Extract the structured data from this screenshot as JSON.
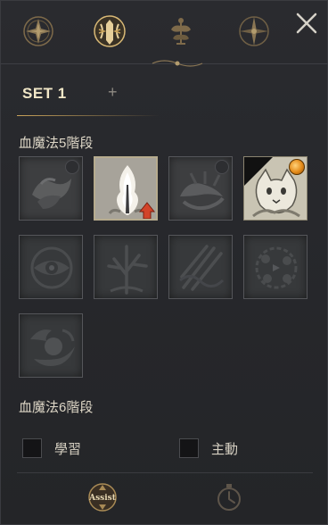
{
  "tabs": [
    {
      "icon": "compass-star-icon"
    },
    {
      "icon": "crest-emblem-icon",
      "selected": true
    },
    {
      "icon": "ornament-tree-icon"
    },
    {
      "icon": "compass-rose-icon"
    }
  ],
  "close_icon": "close-icon",
  "set": {
    "label": "SET 1",
    "add_label": "+"
  },
  "section_5": {
    "title": "血魔法5階段",
    "skills": [
      {
        "icon": "blood-wave-icon",
        "state": "locked",
        "dot": true
      },
      {
        "icon": "blood-flame-sword-icon",
        "state": "selected",
        "level_up": true
      },
      {
        "icon": "blood-claws-icon",
        "state": "locked",
        "dot": true
      },
      {
        "icon": "cat-spirit-icon",
        "state": "bright",
        "orb": true,
        "corner": true
      },
      {
        "icon": "blood-eye-icon",
        "state": "dim"
      },
      {
        "icon": "blood-tree-icon",
        "state": "dim"
      },
      {
        "icon": "blood-spears-icon",
        "state": "dim"
      },
      {
        "icon": "blood-roses-icon",
        "state": "dim"
      },
      {
        "icon": "blood-orb-icon",
        "state": "dim"
      }
    ]
  },
  "section_6": {
    "title": "血魔法6階段"
  },
  "checkboxes": {
    "learn_label": "學習",
    "active_label": "主動"
  },
  "bottom": {
    "assist_label": "Assist",
    "timer_icon": "stopwatch-icon"
  },
  "colors": {
    "accent_gold": "#c9a35a",
    "panel_bg": "#27282c",
    "level_up_red": "#d2442a",
    "orb_orange": "#e48a18"
  }
}
